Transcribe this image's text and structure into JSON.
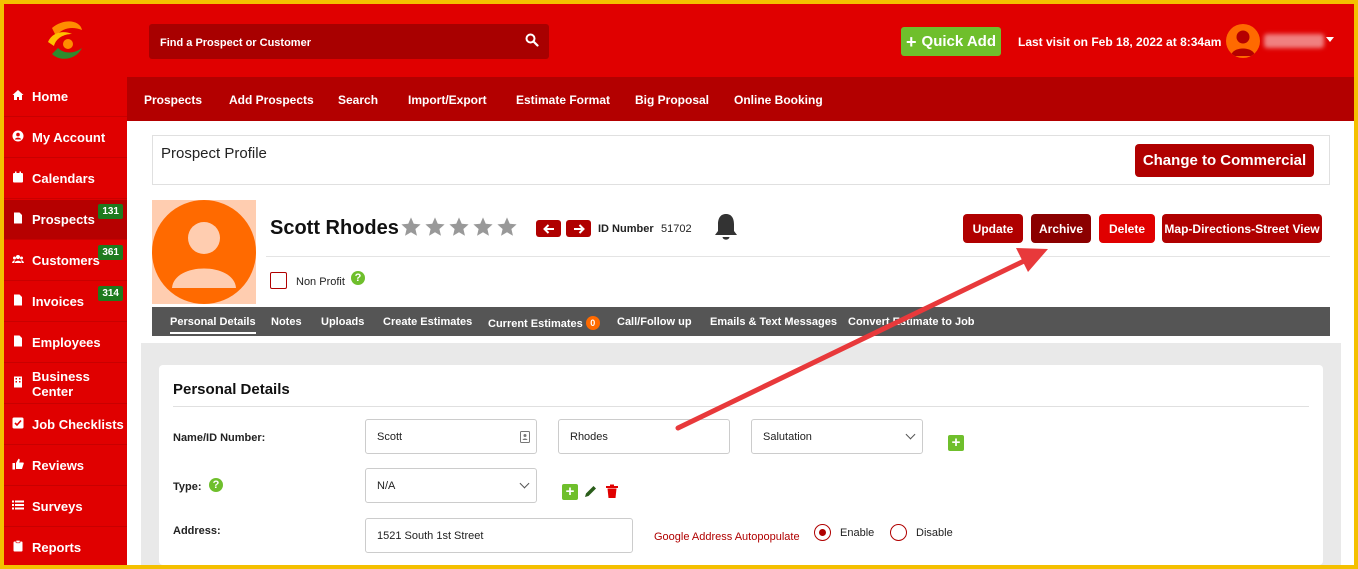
{
  "header": {
    "search_placeholder": "Find a Prospect or Customer",
    "quick_add_label": "Quick Add",
    "last_visit": "Last visit on  Feb 18, 2022  at 8:34am"
  },
  "sidebar": {
    "items": [
      {
        "label": "Home",
        "icon": "home-icon"
      },
      {
        "label": "My Account",
        "icon": "user-circle-icon"
      },
      {
        "label": "Calendars",
        "icon": "calendar-icon"
      },
      {
        "label": "Prospects",
        "icon": "document-icon",
        "badge": "131"
      },
      {
        "label": "Customers",
        "icon": "users-icon",
        "badge": "361"
      },
      {
        "label": "Invoices",
        "icon": "document-icon",
        "badge": "314"
      },
      {
        "label": "Employees",
        "icon": "document-icon"
      },
      {
        "label": "Business Center",
        "icon": "building-icon"
      },
      {
        "label": "Job Checklists",
        "icon": "checkbox-icon"
      },
      {
        "label": "Reviews",
        "icon": "thumbs-up-icon"
      },
      {
        "label": "Surveys",
        "icon": "list-icon"
      },
      {
        "label": "Reports",
        "icon": "clipboard-icon"
      }
    ]
  },
  "subnav": {
    "items": [
      "Prospects",
      "Add Prospects",
      "Search",
      "Import/Export",
      "Estimate Format",
      "Big Proposal",
      "Online Booking"
    ]
  },
  "profile": {
    "title": "Prospect Profile",
    "change_commercial": "Change to Commercial",
    "name": "Scott Rhodes",
    "rating": 0,
    "rating_max": 5,
    "id_label": "ID Number",
    "id_value": "51702",
    "buttons": {
      "update": "Update",
      "archive": "Archive",
      "delete": "Delete",
      "map": "Map-Directions-Street View"
    },
    "non_profit_label": "Non Profit"
  },
  "tabs": {
    "items": [
      "Personal Details",
      "Notes",
      "Uploads",
      "Create Estimates",
      "Current Estimates",
      "Call/Follow up",
      "Emails & Text Messages",
      "Convert Estimate to Job"
    ],
    "current_estimates_count": "0"
  },
  "personal_details": {
    "title": "Personal Details",
    "name_label": "Name/ID Number:",
    "first_name": "Scott",
    "last_name": "Rhodes",
    "salutation": "Salutation",
    "type_label": "Type:",
    "type_value": "N/A",
    "address_label": "Address:",
    "address_value": "1521 South 1st Street",
    "autopopulate_label": "Google Address Autopopulate",
    "enable_label": "Enable",
    "disable_label": "Disable"
  },
  "colors": {
    "brand_red": "#e00000",
    "dark_red": "#b00000",
    "accent_green": "#6fbf2c",
    "avatar_orange": "#ff6a00",
    "border_yellow": "#f4c000"
  }
}
